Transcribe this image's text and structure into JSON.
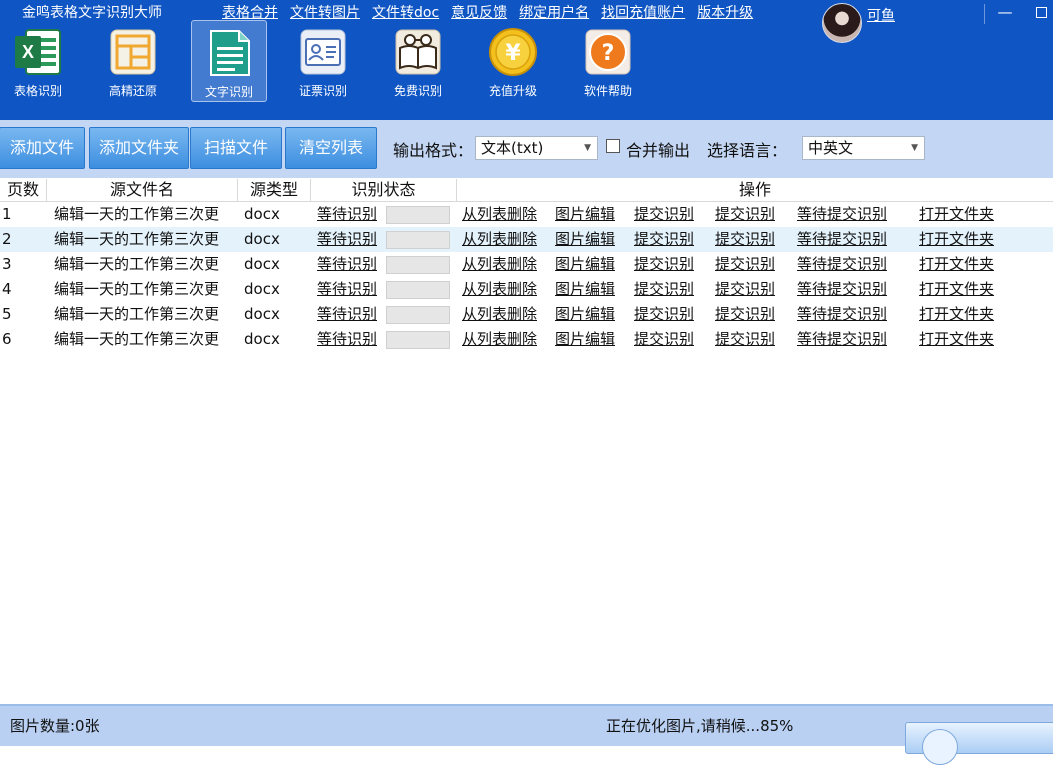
{
  "app": {
    "title": "金鸣表格文字识别大师"
  },
  "top_links": [
    "表格合并",
    "文件转图片",
    "文件转doc",
    "意见反馈",
    "绑定用户名",
    "找回充值账户",
    "版本升级"
  ],
  "user": {
    "name": "可鱼"
  },
  "window": {
    "minimize": "—"
  },
  "tools": [
    {
      "label": "表格识别",
      "icon": "excel-icon"
    },
    {
      "label": "高精还原",
      "icon": "layout-icon"
    },
    {
      "label": "文字识别",
      "icon": "document-icon",
      "active": true
    },
    {
      "label": "证票识别",
      "icon": "id-card-icon"
    },
    {
      "label": "免费识别",
      "icon": "book-glasses-icon"
    },
    {
      "label": "充值升级",
      "icon": "yen-coin-icon"
    },
    {
      "label": "软件帮助",
      "icon": "help-icon"
    }
  ],
  "actions": {
    "add_file": "添加文件",
    "add_folder": "添加文件夹",
    "scan_file": "扫描文件",
    "clear_list": "清空列表"
  },
  "output": {
    "format_label": "输出格式：",
    "format_value": "文本(txt)",
    "merge_label": "合并输出",
    "merge_checked": false,
    "language_label": "选择语言：",
    "language_value": "中英文"
  },
  "table": {
    "columns": [
      "页数",
      "源文件名",
      "源类型",
      "识别状态",
      "操作"
    ],
    "row_actions": [
      "从列表删除",
      "图片编辑",
      "提交识别",
      "提交识别",
      "等待提交识别",
      "打开文件夹"
    ],
    "rows": [
      {
        "page": "1",
        "file": "编辑一天的工作第三次更",
        "type": "docx",
        "status": "等待识别",
        "progress": 0
      },
      {
        "page": "2",
        "file": "编辑一天的工作第三次更",
        "type": "docx",
        "status": "等待识别",
        "progress": 0,
        "selected": true
      },
      {
        "page": "3",
        "file": "编辑一天的工作第三次更",
        "type": "docx",
        "status": "等待识别",
        "progress": 0
      },
      {
        "page": "4",
        "file": "编辑一天的工作第三次更",
        "type": "docx",
        "status": "等待识别",
        "progress": 0
      },
      {
        "page": "5",
        "file": "编辑一天的工作第三次更",
        "type": "docx",
        "status": "等待识别",
        "progress": 0
      },
      {
        "page": "6",
        "file": "编辑一天的工作第三次更",
        "type": "docx",
        "status": "等待识别",
        "progress": 0
      }
    ]
  },
  "status": {
    "image_count": "图片数量:0张",
    "progress_text": "正在优化图片,请稍候...85%"
  },
  "colors": {
    "header_bg": "#0f56c4",
    "toolbar_bg": "#c3d6f3",
    "button_bg": "#3d8ee0",
    "selected_row": "#e4f2fc",
    "status_bg": "#b9d0f2"
  }
}
